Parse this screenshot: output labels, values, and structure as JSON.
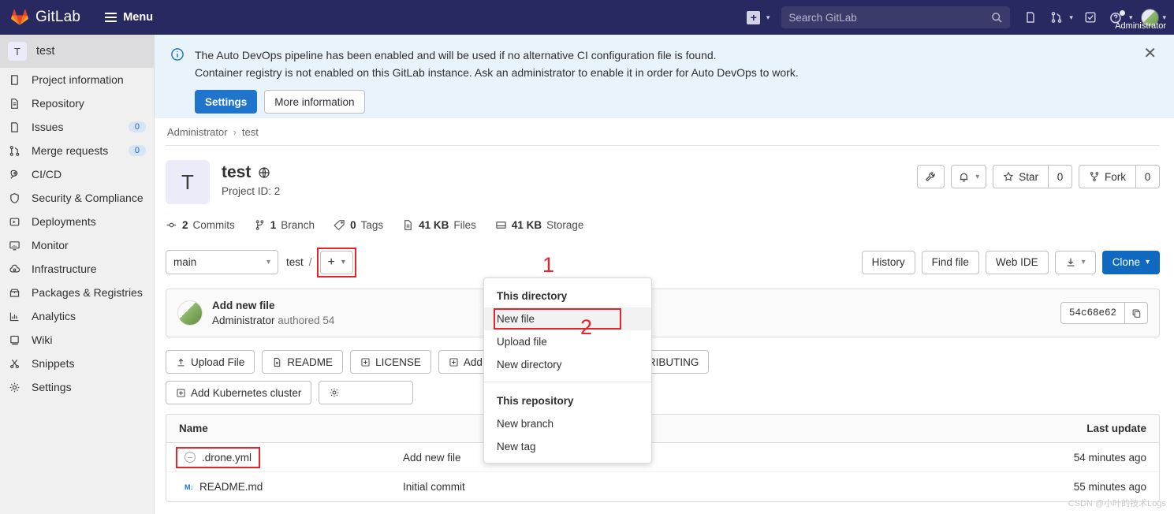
{
  "topbar": {
    "brand": "GitLab",
    "menu_label": "Menu",
    "search_placeholder": "Search GitLab",
    "user_label": "Administrator",
    "icons": [
      "plus-icon",
      "search-icon",
      "issues-icon",
      "merge-requests-icon",
      "todos-icon",
      "help-icon",
      "avatar"
    ]
  },
  "sidebar": {
    "project_initial": "T",
    "project_name": "test",
    "items": [
      {
        "label": "Project information",
        "icon": "book-icon",
        "badge": ""
      },
      {
        "label": "Repository",
        "icon": "document-icon",
        "badge": ""
      },
      {
        "label": "Issues",
        "icon": "issues-icon",
        "badge": "0"
      },
      {
        "label": "Merge requests",
        "icon": "merge-icon",
        "badge": "0"
      },
      {
        "label": "CI/CD",
        "icon": "rocket-icon",
        "badge": ""
      },
      {
        "label": "Security & Compliance",
        "icon": "shield-icon",
        "badge": ""
      },
      {
        "label": "Deployments",
        "icon": "deploy-icon",
        "badge": ""
      },
      {
        "label": "Monitor",
        "icon": "monitor-icon",
        "badge": ""
      },
      {
        "label": "Infrastructure",
        "icon": "cloud-icon",
        "badge": ""
      },
      {
        "label": "Packages & Registries",
        "icon": "package-icon",
        "badge": ""
      },
      {
        "label": "Analytics",
        "icon": "chart-icon",
        "badge": ""
      },
      {
        "label": "Wiki",
        "icon": "wiki-icon",
        "badge": ""
      },
      {
        "label": "Snippets",
        "icon": "scissors-icon",
        "badge": ""
      },
      {
        "label": "Settings",
        "icon": "gear-icon",
        "badge": ""
      }
    ]
  },
  "alert": {
    "line1": "The Auto DevOps pipeline has been enabled and will be used if no alternative CI configuration file is found.",
    "line2": "Container registry is not enabled on this GitLab instance. Ask an administrator to enable it in order for Auto DevOps to work.",
    "settings_label": "Settings",
    "more_label": "More information",
    "close_label": "✕"
  },
  "breadcrumb": {
    "owner": "Administrator",
    "sep": "›",
    "project": "test"
  },
  "project": {
    "initial": "T",
    "title": "test",
    "visibility_icon": "globe-icon",
    "project_id": "Project ID: 2",
    "stats": [
      {
        "value": "2",
        "label": "Commits",
        "icon": "commit-icon"
      },
      {
        "value": "1",
        "label": "Branch",
        "icon": "branch-icon"
      },
      {
        "value": "0",
        "label": "Tags",
        "icon": "tag-icon"
      },
      {
        "value": "41 KB",
        "label": "Files",
        "icon": "file-icon"
      },
      {
        "value": "41 KB",
        "label": "Storage",
        "icon": "storage-icon"
      }
    ],
    "actions": {
      "wrench_icon": "wrench-icon",
      "notification_icon": "bell-icon",
      "star_label": "Star",
      "star_count": "0",
      "fork_label": "Fork",
      "fork_count": "0"
    }
  },
  "repo_bar": {
    "branch": "main",
    "path": "test",
    "path_sep": "/",
    "plus_label": "+",
    "history_label": "History",
    "find_file_label": "Find file",
    "web_ide_label": "Web IDE",
    "download_icon": "download-icon",
    "clone_label": "Clone"
  },
  "commit": {
    "title": "Add new file",
    "author": "Administrator",
    "rest": "authored 54",
    "sha": "54c68e62",
    "copy_icon": "copy-icon"
  },
  "quick_actions": {
    "row1": [
      {
        "label": "Upload File",
        "icon": "upload-icon"
      },
      {
        "label": "README",
        "icon": "file-icon"
      },
      {
        "label": "LICENSE",
        "icon": "plus-box-icon"
      },
      {
        "label": "Add CHANGELOG",
        "icon": "plus-box-icon"
      },
      {
        "label": "Add CONTRIBUTING",
        "icon": "plus-box-icon"
      }
    ],
    "row2": [
      {
        "label": "Add Kubernetes cluster",
        "icon": "plus-box-icon"
      },
      {
        "label": "",
        "icon": "gear-icon"
      }
    ]
  },
  "dropdown": {
    "section1_title": "This directory",
    "section1_items": [
      "New file",
      "Upload file",
      "New directory"
    ],
    "section2_title": "This repository",
    "section2_items": [
      "New branch",
      "New tag"
    ],
    "selected": "New file"
  },
  "file_table": {
    "headers": {
      "name": "Name",
      "message": "",
      "last_update": "Last update"
    },
    "rows": [
      {
        "name": ".drone.yml",
        "icon": "drone-icon",
        "message": "Add new file",
        "last_update": "54 minutes ago",
        "highlighted": true
      },
      {
        "name": "README.md",
        "icon": "markdown-icon",
        "message": "Initial commit",
        "last_update": "55 minutes ago",
        "highlighted": false
      }
    ]
  },
  "annotations": {
    "step1": "1",
    "step2": "2"
  },
  "watermark": "CSDN @小叶的技术Logs"
}
